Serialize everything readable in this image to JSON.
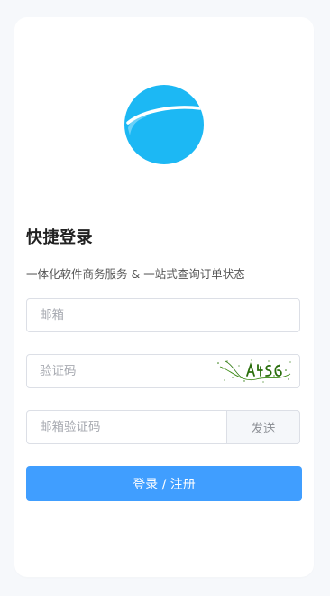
{
  "login": {
    "title": "快捷登录",
    "subtitle": "一体化软件商务服务 & 一站式查询订单状态",
    "email_placeholder": "邮箱",
    "captcha_placeholder": "验证码",
    "captcha_image": "captcha-image",
    "email_code_placeholder": "邮箱验证码",
    "send_label": "发送",
    "submit_label": "登录 / 注册"
  },
  "colors": {
    "logo": "#1cb8f4",
    "primary_button": "#409eff",
    "page_background": "#f6f8fb"
  }
}
